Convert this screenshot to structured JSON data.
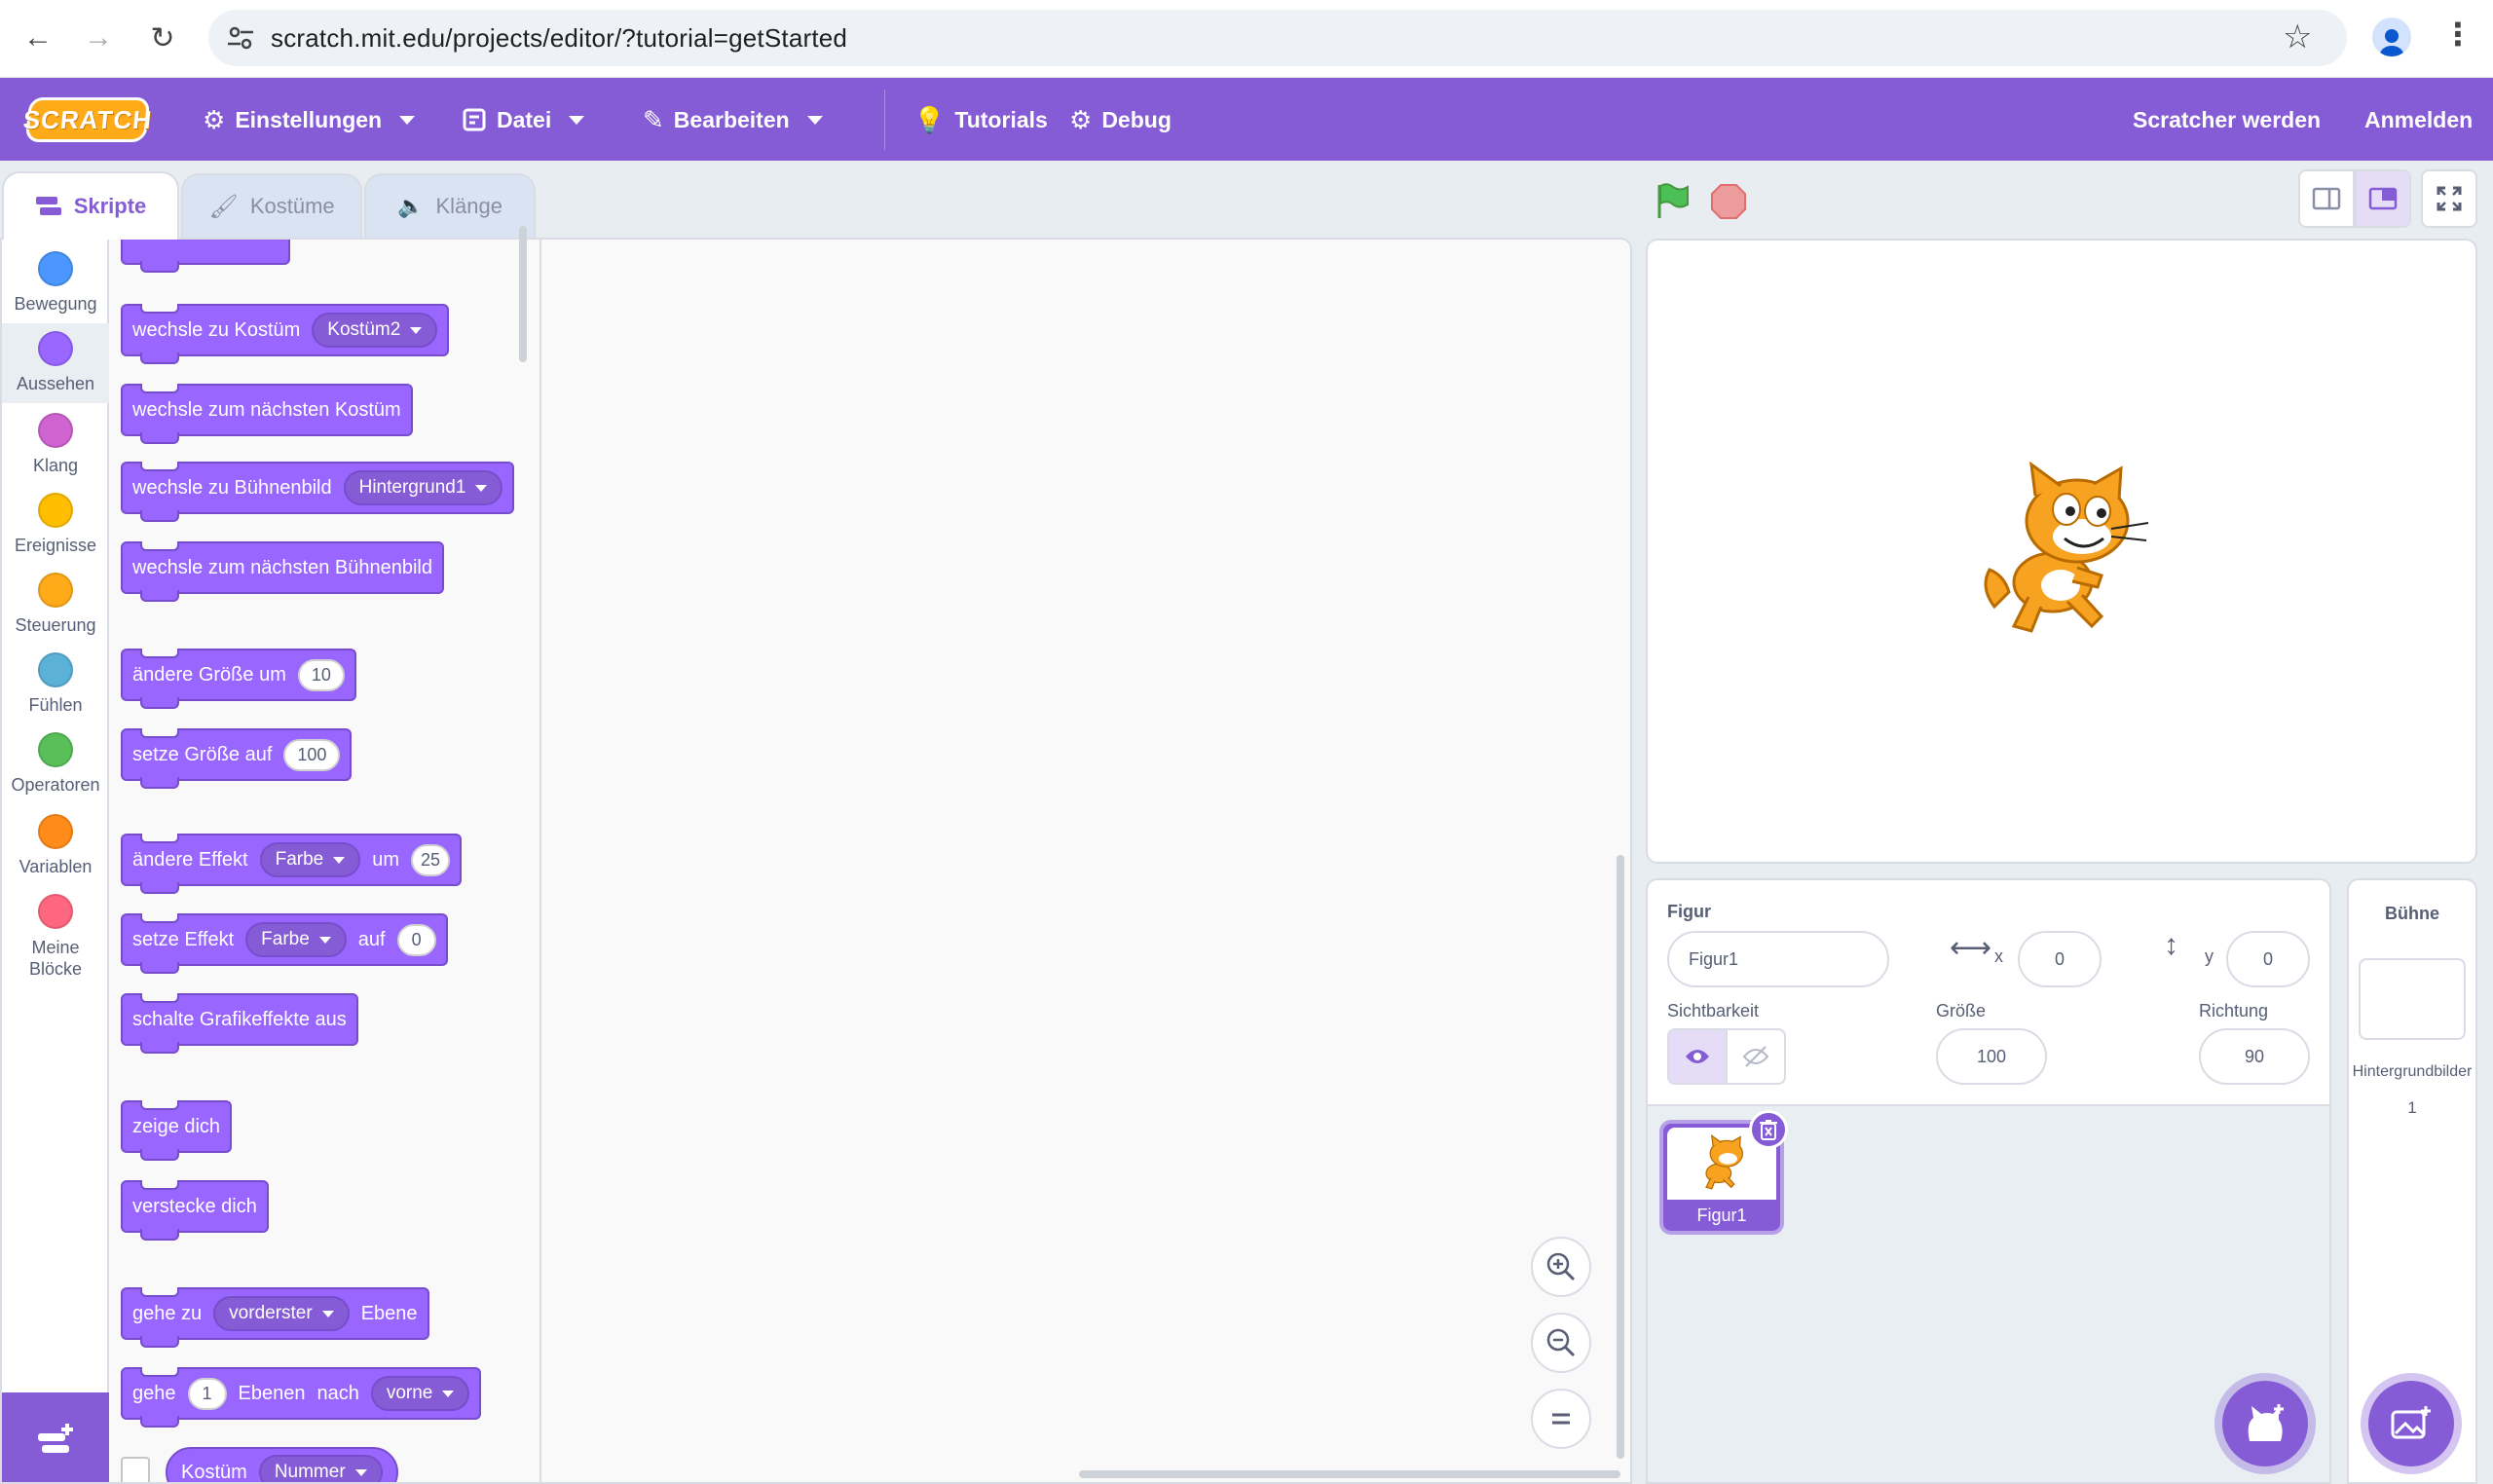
{
  "browser": {
    "url": "scratch.mit.edu/projects/editor/?tutorial=getStarted"
  },
  "menu": {
    "logo": "SCRATCH",
    "settings": "Einstellungen",
    "file": "Datei",
    "edit": "Bearbeiten",
    "tutorials": "Tutorials",
    "debug": "Debug",
    "join": "Scratcher werden",
    "signin": "Anmelden"
  },
  "tabs": {
    "code": "Skripte",
    "costumes": "Kostüme",
    "sounds": "Klänge"
  },
  "categories": [
    {
      "label": "Bewegung",
      "color": "#4c97ff"
    },
    {
      "label": "Aussehen",
      "color": "#9966ff"
    },
    {
      "label": "Klang",
      "color": "#cf63cf"
    },
    {
      "label": "Ereignisse",
      "color": "#ffbf00"
    },
    {
      "label": "Steuerung",
      "color": "#ffab19"
    },
    {
      "label": "Fühlen",
      "color": "#5cb1d6"
    },
    {
      "label": "Operatoren",
      "color": "#59c059"
    },
    {
      "label": "Variablen",
      "color": "#ff8c1a"
    },
    {
      "label": "Meine Blöcke",
      "color": "#ff6680"
    }
  ],
  "blocks": {
    "switch_costume": "wechsle zu Kostüm",
    "costume_value": "Kostüm2",
    "next_costume": "wechsle zum nächsten Kostüm",
    "switch_backdrop": "wechsle zu Bühnenbild",
    "backdrop_value": "Hintergrund1",
    "next_backdrop": "wechsle zum nächsten Bühnenbild",
    "change_size": "ändere Größe um",
    "change_size_value": "10",
    "set_size": "setze Größe auf",
    "set_size_value": "100",
    "change_effect": "ändere Effekt",
    "change_effect_option": "Farbe",
    "change_effect_by": "um",
    "change_effect_value": "25",
    "set_effect": "setze Effekt",
    "set_effect_option": "Farbe",
    "set_effect_to": "auf",
    "set_effect_value": "0",
    "clear_effects": "schalte Grafikeffekte aus",
    "show": "zeige dich",
    "hide": "verstecke dich",
    "goto_layer": "gehe zu",
    "goto_layer_option": "vorderster",
    "goto_layer_suffix": "Ebene",
    "go_layers": "gehe",
    "go_layers_value": "1",
    "go_layers_mid": "Ebenen",
    "go_layers_by": "nach",
    "go_layers_option": "vorne",
    "costume_reporter": "Kostüm",
    "costume_reporter_option": "Nummer"
  },
  "sprite_info": {
    "sprite_label": "Figur",
    "sprite_name": "Figur1",
    "x_label": "x",
    "x_value": "0",
    "y_label": "y",
    "y_value": "0",
    "visibility_label": "Sichtbarkeit",
    "size_label": "Größe",
    "size_value": "100",
    "direction_label": "Richtung",
    "direction_value": "90"
  },
  "sprite_list": [
    {
      "name": "Figur1"
    }
  ],
  "stage_target": {
    "title": "Bühne",
    "backdrops_label": "Hintergrundbilder",
    "backdrops_count": "1"
  },
  "colors": {
    "menu": "#855cd6",
    "looks": "#9966ff",
    "flag": "#4cbf56",
    "stop": "#ec5959"
  }
}
